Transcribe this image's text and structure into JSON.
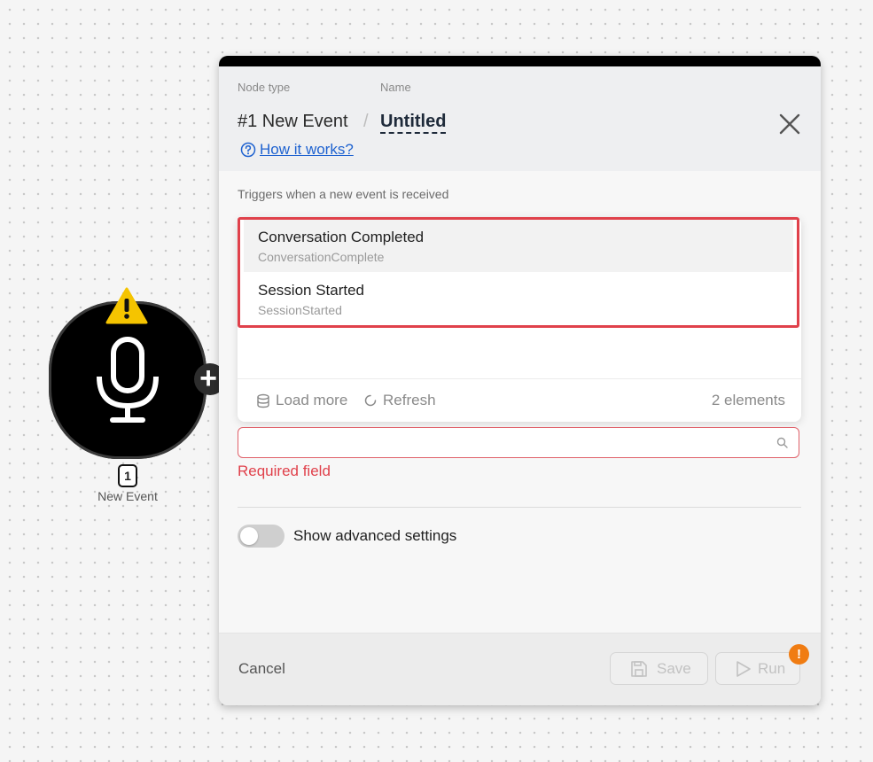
{
  "node": {
    "badge": "1",
    "label": "New Event",
    "icon": "microphone-icon",
    "status_icon": "warning-icon"
  },
  "panel": {
    "node_type_label": "Node type",
    "name_label": "Name",
    "node_type": "#1 New Event",
    "separator": "/",
    "name": "Untitled",
    "how_it_works": "How it works?",
    "description": "Triggers when a new event is received",
    "dropdown": {
      "options": [
        {
          "title": "Conversation Completed",
          "subtitle": "ConversationComplete"
        },
        {
          "title": "Session Started",
          "subtitle": "SessionStarted"
        }
      ],
      "load_more": "Load more",
      "refresh": "Refresh",
      "count": "2 elements"
    },
    "search": {
      "value": "",
      "placeholder": ""
    },
    "required_error": "Required field",
    "advanced_toggle_label": "Show advanced settings",
    "footer": {
      "cancel": "Cancel",
      "save": "Save",
      "run": "Run",
      "run_badge": "!"
    }
  },
  "colors": {
    "error": "#e0414b",
    "link": "#1e62d0",
    "warning_badge": "#f07c12",
    "node_bg": "#000000"
  }
}
